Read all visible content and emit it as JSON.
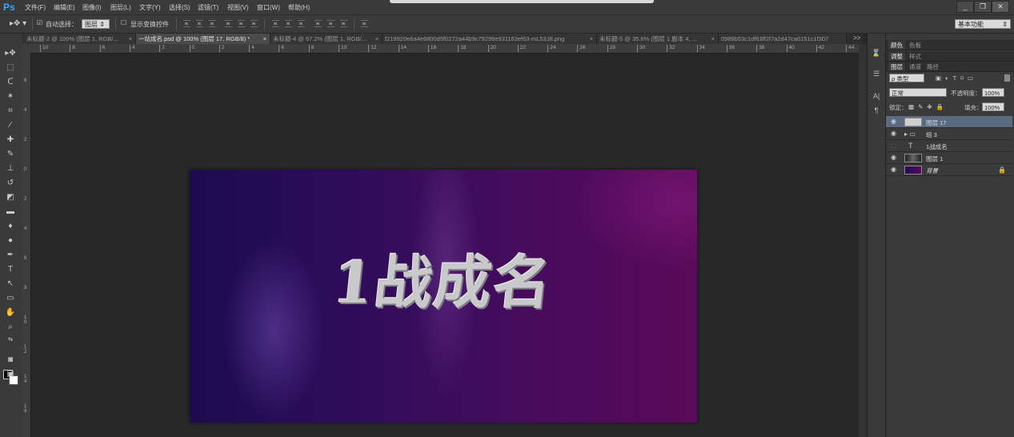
{
  "app": {
    "logo": "Ps"
  },
  "menu": [
    "文件(F)",
    "编辑(E)",
    "图像(I)",
    "图层(L)",
    "文字(Y)",
    "选择(S)",
    "滤镜(T)",
    "视图(V)",
    "窗口(W)",
    "帮助(H)"
  ],
  "window_controls": {
    "minimize": "_",
    "restore": "❐",
    "close": "✕"
  },
  "options": {
    "auto_select_label": "自动选择：",
    "auto_select_value": "图层",
    "show_transform_label": "显示变换控件",
    "workspace": "基本功能"
  },
  "doc_tabs": [
    {
      "label": "未标题-2 @ 100% (图层 1, RGB/...",
      "close": "×"
    },
    {
      "label": "一站成名.psd @ 100% (图层 17, RGB/8) *",
      "close": "×"
    },
    {
      "label": "未标题-4 @ 67.2% (图层 1, RGB/...",
      "close": "×"
    },
    {
      "label": "f219920e6a4e8800d5f0272a44b9c79299e931163ef63-mL53J8.png",
      "close": "×"
    },
    {
      "label": "未标题-5 @ 35.6% (图层 1 副本 4, ...",
      "close": "×"
    },
    {
      "label": "0989b53c1df63ff2f7a2d47ca0151c1f307",
      "close": ""
    }
  ],
  "tabs_overflow": ">>",
  "ruler_top_ticks": [
    "10",
    "8",
    "6",
    "4",
    "2",
    "0",
    "2",
    "4",
    "6",
    "8",
    "10",
    "12",
    "14",
    "16",
    "18",
    "20",
    "22",
    "24",
    "26",
    "28",
    "30",
    "32",
    "34",
    "36",
    "38",
    "40",
    "42",
    "44"
  ],
  "ruler_left_ticks": [
    "6",
    "4",
    "2",
    "0",
    "2",
    "4",
    "6",
    "8",
    "1\n0",
    "1\n2",
    "1\n4",
    "1\n6"
  ],
  "canvas": {
    "text": "1战成名"
  },
  "panels": {
    "top_tabs": [
      "颜色",
      "色板"
    ],
    "second_tabs": [
      "调整",
      "样式"
    ],
    "layer_tabs": [
      "图层",
      "通道",
      "路径"
    ],
    "filter_kind": "ρ 类型",
    "blend_mode": "正常",
    "opacity_label": "不透明度：",
    "opacity_value": "100%",
    "lock_label": "锁定：",
    "fill_label": "填充：",
    "fill_value": "100%"
  },
  "layers": [
    {
      "name": "图层 17",
      "visible": true,
      "selected": true,
      "kind": "pixel"
    },
    {
      "name": "组 3",
      "visible": true,
      "selected": false,
      "kind": "group"
    },
    {
      "name": "1战成名",
      "visible": false,
      "selected": false,
      "kind": "text"
    },
    {
      "name": "图层 1",
      "visible": true,
      "selected": false,
      "kind": "pixel"
    },
    {
      "name": "背景",
      "visible": true,
      "selected": false,
      "kind": "background",
      "locked": true
    }
  ]
}
